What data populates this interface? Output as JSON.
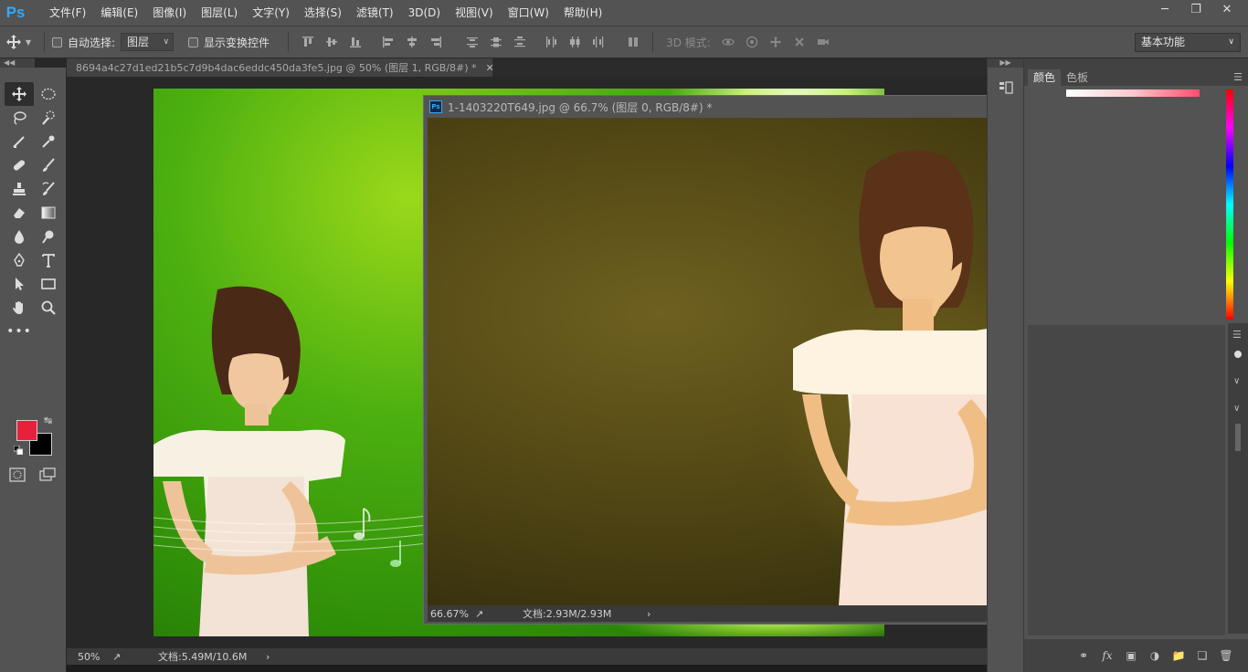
{
  "app": {
    "logo": "Ps",
    "menu": [
      "文件(F)",
      "编辑(E)",
      "图像(I)",
      "图层(L)",
      "文字(Y)",
      "选择(S)",
      "滤镜(T)",
      "3D(D)",
      "视图(V)",
      "窗口(W)",
      "帮助(H)"
    ],
    "window_controls": [
      "minimize-icon",
      "restore-icon",
      "close-icon"
    ]
  },
  "options": {
    "auto_select_label": "自动选择:",
    "auto_select_value": "图层",
    "show_transform_label": "显示变换控件",
    "mode_3d_label": "3D 模式:",
    "workspace": "基本功能"
  },
  "colors": {
    "foreground": "#e8203a",
    "background": "#000000",
    "accent": "#31a8ff",
    "chrome": "#535353"
  },
  "document": {
    "tab_title": "8694a4c27d1ed21b5c7d9b4dac6eddc450da3fe5.jpg @ 50% (图层 1, RGB/8#) *",
    "zoom": "50%",
    "doc_info": "文档:5.49M/10.6M"
  },
  "floating_window": {
    "title": "1-1403220T649.jpg @ 66.7% (图层 0, RGB/8#) *",
    "zoom": "66.67%",
    "doc_info": "文档:2.93M/2.93M"
  },
  "panels": {
    "tabs": [
      "颜色",
      "色板"
    ]
  }
}
